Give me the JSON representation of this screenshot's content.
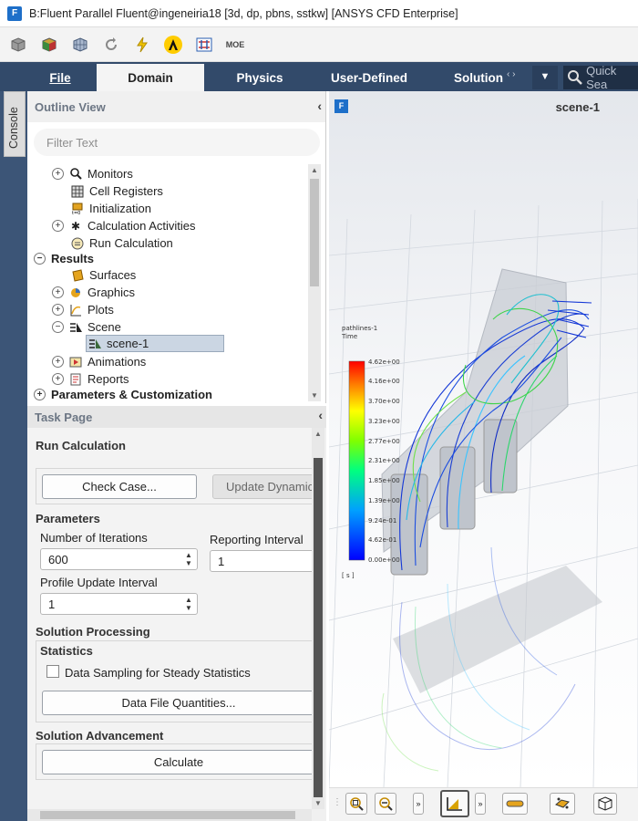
{
  "window": {
    "title": "B:Fluent Parallel Fluent@ingeneiria18  [3d, dp, pbns, sstkw] [ANSYS CFD Enterprise]",
    "app_badge": "F"
  },
  "toolbar": {
    "icons": [
      "cube-icon",
      "colored-cube-icon",
      "mesh-cube-icon",
      "refresh-icon",
      "lightning-icon",
      "ansys-logo-icon",
      "parallel-icon",
      "moe-icon"
    ],
    "moe_text": "MOE"
  },
  "ribbon": {
    "tabs": [
      "File",
      "Domain",
      "Physics",
      "User-Defined",
      "Solution"
    ],
    "active_tab": "Domain",
    "search_placeholder": "Quick Sea"
  },
  "console_tab": "Console",
  "outline": {
    "title": "Outline View",
    "filter_placeholder": "Filter Text",
    "items": [
      {
        "label": "Monitors",
        "expander": "+",
        "icon": "magnifier-icon"
      },
      {
        "label": "Cell Registers",
        "expander": "",
        "icon": "grid-icon"
      },
      {
        "label": "Initialization",
        "expander": "",
        "icon": "init-icon"
      },
      {
        "label": "Calculation Activities",
        "expander": "+",
        "icon": "gear-icon"
      },
      {
        "label": "Run Calculation",
        "expander": "",
        "icon": "run-icon"
      },
      {
        "label": "Results",
        "expander": "−",
        "icon": ""
      },
      {
        "label": "Surfaces",
        "expander": "",
        "icon": "surface-icon"
      },
      {
        "label": "Graphics",
        "expander": "+",
        "icon": "graphics-icon"
      },
      {
        "label": "Plots",
        "expander": "+",
        "icon": "plot-icon"
      },
      {
        "label": "Scene",
        "expander": "−",
        "icon": "scene-icon"
      },
      {
        "label": "scene-1",
        "expander": "",
        "icon": "scene-item-icon"
      },
      {
        "label": "Animations",
        "expander": "+",
        "icon": "animation-icon"
      },
      {
        "label": "Reports",
        "expander": "+",
        "icon": "report-icon"
      },
      {
        "label": "Parameters & Customization",
        "expander": "+",
        "icon": ""
      }
    ]
  },
  "task": {
    "title": "Task Page",
    "heading": "Run Calculation",
    "check_case": "Check Case...",
    "update_dynamic": "Update Dynamic",
    "parameters_label": "Parameters",
    "iterations_label": "Number of Iterations",
    "iterations_value": "600",
    "reporting_label": "Reporting Interval",
    "reporting_value": "1",
    "profile_label": "Profile Update Interval",
    "profile_value": "1",
    "solution_processing": "Solution Processing",
    "statistics": "Statistics",
    "data_sampling": "Data Sampling for Steady Statistics",
    "data_sampling_checked": false,
    "data_file_quantities": "Data File Quantities...",
    "solution_advancement": "Solution Advancement",
    "calculate": "Calculate"
  },
  "viewport": {
    "badge": "F",
    "title": "scene-1",
    "legend_title": "pathlines-1",
    "legend_subtitle": "Time",
    "legend_ticks": [
      "4.62e+00",
      "4.16e+00",
      "3.70e+00",
      "3.23e+00",
      "2.77e+00",
      "2.31e+00",
      "1.85e+00",
      "1.39e+00",
      "9.24e-01",
      "4.62e-01",
      "0.00e+00"
    ],
    "legend_unit": "[ s ]"
  },
  "bottom_toolbar": {
    "icons": [
      "zoom-fit-icon",
      "zoom-out-icon",
      "more-icon",
      "view-icon",
      "more-icon",
      "ruler-icon",
      "camera-icon",
      "cube-view-icon"
    ]
  }
}
